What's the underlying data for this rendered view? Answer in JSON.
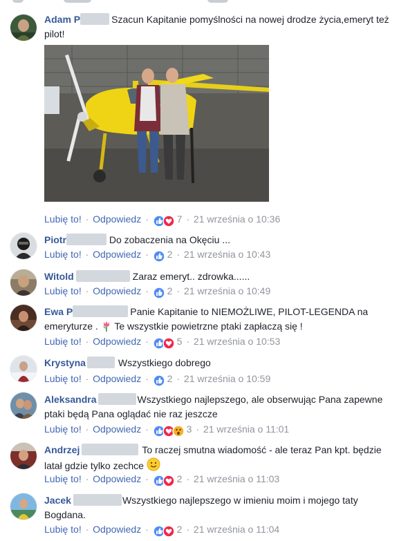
{
  "comments": [
    {
      "name": "Adam P",
      "text": "Szacun Kapitanie pomyślności na nowej drodze życia,emeryt też pilot!",
      "like": "Lubię to!",
      "reply": "Odpowiedz",
      "count": "7",
      "time": "21 września o 10:36",
      "reactions": [
        "like-icon",
        "heart-icon"
      ]
    },
    {
      "name": "Piotr",
      "text": "Do zobaczenia na Okęciu ...",
      "like": "Lubię to!",
      "reply": "Odpowiedz",
      "count": "2",
      "time": "21 września o 10:43",
      "reactions": [
        "like-icon"
      ]
    },
    {
      "name": "Witold",
      "text": "Zaraz emeryt.. zdrowka......",
      "like": "Lubię to!",
      "reply": "Odpowiedz",
      "count": "2",
      "time": "21 września o 10:49",
      "reactions": [
        "like-icon"
      ]
    },
    {
      "name": "Ewa P",
      "text_a": "Panie Kapitanie to NIEMOŻLIWE, PILOT-LEGENDA na emeryturze .",
      "text_b": "Te wszystkie powietrzne ptaki zapłaczą się !",
      "like": "Lubię to!",
      "reply": "Odpowiedz",
      "count": "5",
      "time": "21 września o 10:53",
      "reactions": [
        "like-icon",
        "heart-icon"
      ],
      "emoji": "tulip-emoji"
    },
    {
      "name": "Krystyna",
      "text": "Wszystkiego dobrego",
      "like": "Lubię to!",
      "reply": "Odpowiedz",
      "count": "2",
      "time": "21 września o 10:59",
      "reactions": [
        "like-icon"
      ]
    },
    {
      "name": "Aleksandra",
      "text": "Wszystkiego najlepszego, ale obserwując Pana zapewne ptaki będą Pana oglądać nie raz jeszcze",
      "like": "Lubię to!",
      "reply": "Odpowiedz",
      "count": "3",
      "time": "21 września o 11:01",
      "reactions": [
        "like-icon",
        "heart-icon",
        "wow-icon"
      ]
    },
    {
      "name": "Andrzej",
      "text": "To raczej smutna wiadomość - ale teraz Pan kpt. będzie latał gdzie tylko zechce",
      "like": "Lubię to!",
      "reply": "Odpowiedz",
      "count": "2",
      "time": "21 września o 11:03",
      "reactions": [
        "like-icon",
        "heart-icon"
      ],
      "emoji": "smile-emoji"
    },
    {
      "name": "Jacek",
      "text": "Wszystkiego najlepszego w imieniu moim i mojego taty Bogdana.",
      "like": "Lubię to!",
      "reply": "Odpowiedz",
      "count": "2",
      "time": "21 września o 11:04",
      "reactions": [
        "like-icon",
        "heart-icon"
      ]
    }
  ],
  "colors": {
    "name": "#365899",
    "link": "#4267b2",
    "meta": "#90949c",
    "like": "#4f8cf6",
    "heart": "#f0284a",
    "wow": "#f7b125"
  }
}
